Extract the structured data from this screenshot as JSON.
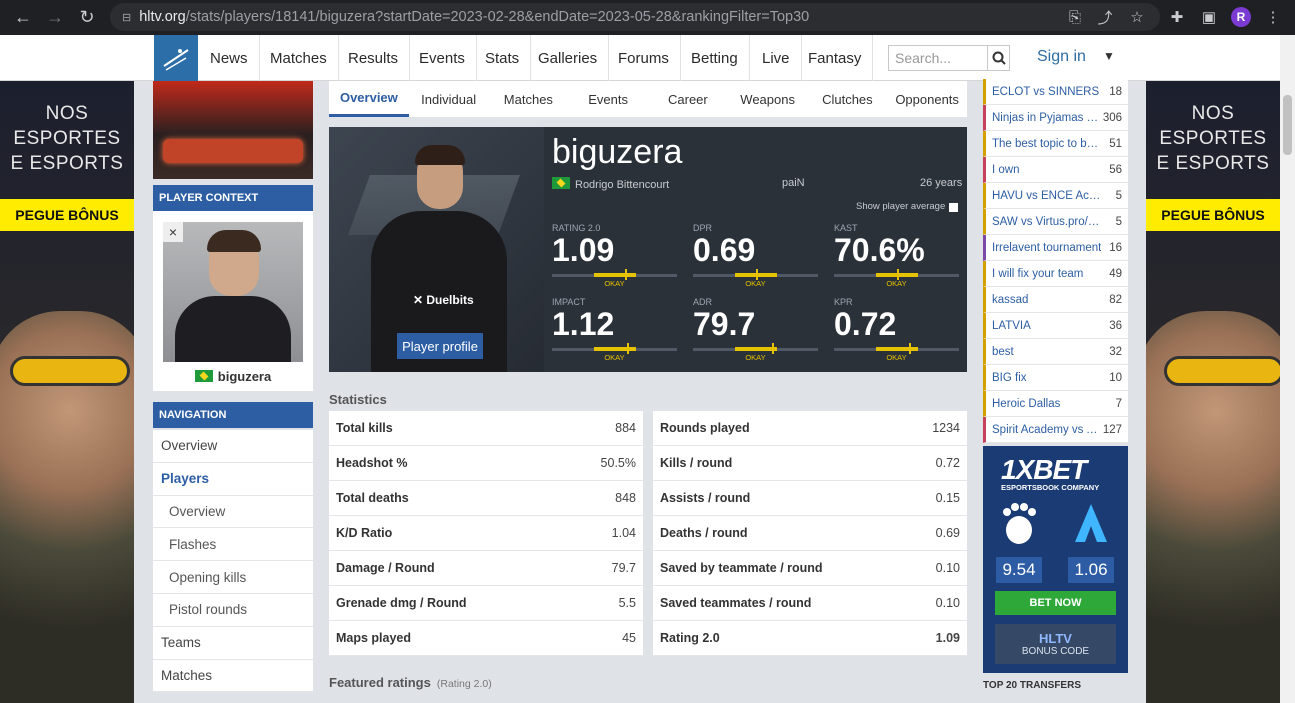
{
  "browser": {
    "url_host": "hltv.org",
    "url_path": "/stats/players/18141/biguzera?startDate=2023-02-28&endDate=2023-05-28&rankingFilter=Top30",
    "avatar_letter": "R"
  },
  "nav": {
    "items": [
      "News",
      "Matches",
      "Results",
      "Events",
      "Stats",
      "Galleries",
      "Forums",
      "Betting",
      "Live",
      "Fantasy"
    ],
    "search_placeholder": "Search...",
    "signin": "Sign in"
  },
  "ads": {
    "text_line1": "NOS",
    "text_line2": "ESPORTES",
    "text_line3": "E ESPORTS",
    "button": "PEGUE BÔNUS"
  },
  "player_context": {
    "heading": "PLAYER CONTEXT",
    "close": "×",
    "name": "biguzera"
  },
  "navigation": {
    "heading": "NAVIGATION",
    "items": [
      "Overview",
      "Players",
      "Overview",
      "Flashes",
      "Opening kills",
      "Pistol rounds",
      "Teams",
      "Matches"
    ]
  },
  "tabs": [
    "Overview",
    "Individual",
    "Matches",
    "Events",
    "Career",
    "Weapons",
    "Clutches",
    "Opponents"
  ],
  "summary": {
    "nickname": "biguzera",
    "real_name": "Rodrigo Bittencourt",
    "team": "paiN",
    "age": "26 years",
    "show_avg": "Show player average",
    "profile_button": "Player profile",
    "shirt_brand": "✕ Duelbits",
    "stats": [
      {
        "label": "RATING 2.0",
        "value": "1.09",
        "rating": "OKAY",
        "level": 0.58
      },
      {
        "label": "DPR",
        "value": "0.69",
        "rating": "OKAY",
        "level": 0.5
      },
      {
        "label": "KAST",
        "value": "70.6%",
        "rating": "OKAY",
        "level": 0.5
      },
      {
        "label": "IMPACT",
        "value": "1.12",
        "rating": "OKAY",
        "level": 0.6
      },
      {
        "label": "ADR",
        "value": "79.7",
        "rating": "OKAY",
        "level": 0.63
      },
      {
        "label": "KPR",
        "value": "0.72",
        "rating": "OKAY",
        "level": 0.6
      }
    ]
  },
  "statistics": {
    "heading": "Statistics",
    "left": [
      {
        "k": "Total kills",
        "v": "884"
      },
      {
        "k": "Headshot %",
        "v": "50.5%"
      },
      {
        "k": "Total deaths",
        "v": "848"
      },
      {
        "k": "K/D Ratio",
        "v": "1.04"
      },
      {
        "k": "Damage / Round",
        "v": "79.7"
      },
      {
        "k": "Grenade dmg / Round",
        "v": "5.5"
      },
      {
        "k": "Maps played",
        "v": "45"
      }
    ],
    "right": [
      {
        "k": "Rounds played",
        "v": "1234"
      },
      {
        "k": "Kills / round",
        "v": "0.72"
      },
      {
        "k": "Assists / round",
        "v": "0.15"
      },
      {
        "k": "Deaths / round",
        "v": "0.69"
      },
      {
        "k": "Saved by teammate / round",
        "v": "0.10"
      },
      {
        "k": "Saved teammates / round",
        "v": "0.10"
      },
      {
        "k": "Rating 2.0",
        "v": "1.09"
      }
    ]
  },
  "featured": {
    "title": "Featured ratings",
    "sub": "(Rating 2.0)"
  },
  "threads": [
    {
      "name": "ECLOT vs SINNERS",
      "count": "18"
    },
    {
      "name": "Ninjas in Pyjamas vs...",
      "count": "306"
    },
    {
      "name": "The best topic to bait...",
      "count": "51"
    },
    {
      "name": "I own",
      "count": "56"
    },
    {
      "name": "HAVU vs ENCE Academy",
      "count": "5"
    },
    {
      "name": "SAW vs Virtus.pro/1WI...",
      "count": "5"
    },
    {
      "name": "Irrelavent tournament",
      "count": "16"
    },
    {
      "name": "I will fix your team",
      "count": "49"
    },
    {
      "name": "kassad",
      "count": "82"
    },
    {
      "name": "LATVIA",
      "count": "36"
    },
    {
      "name": "best",
      "count": "32"
    },
    {
      "name": "BIG fix",
      "count": "10"
    },
    {
      "name": "Heroic Dallas",
      "count": "7"
    },
    {
      "name": "Spirit Academy vs A...",
      "count": "127"
    }
  ],
  "bet": {
    "logo": "1XBET",
    "sub": "ESPORTSBOOK COMPANY",
    "odd1": "9.54",
    "odd2": "1.06",
    "button": "BET NOW",
    "bonus_title": "HLTV",
    "bonus_sub": "BONUS CODE"
  },
  "transfers": "TOP 20 TRANSFERS"
}
